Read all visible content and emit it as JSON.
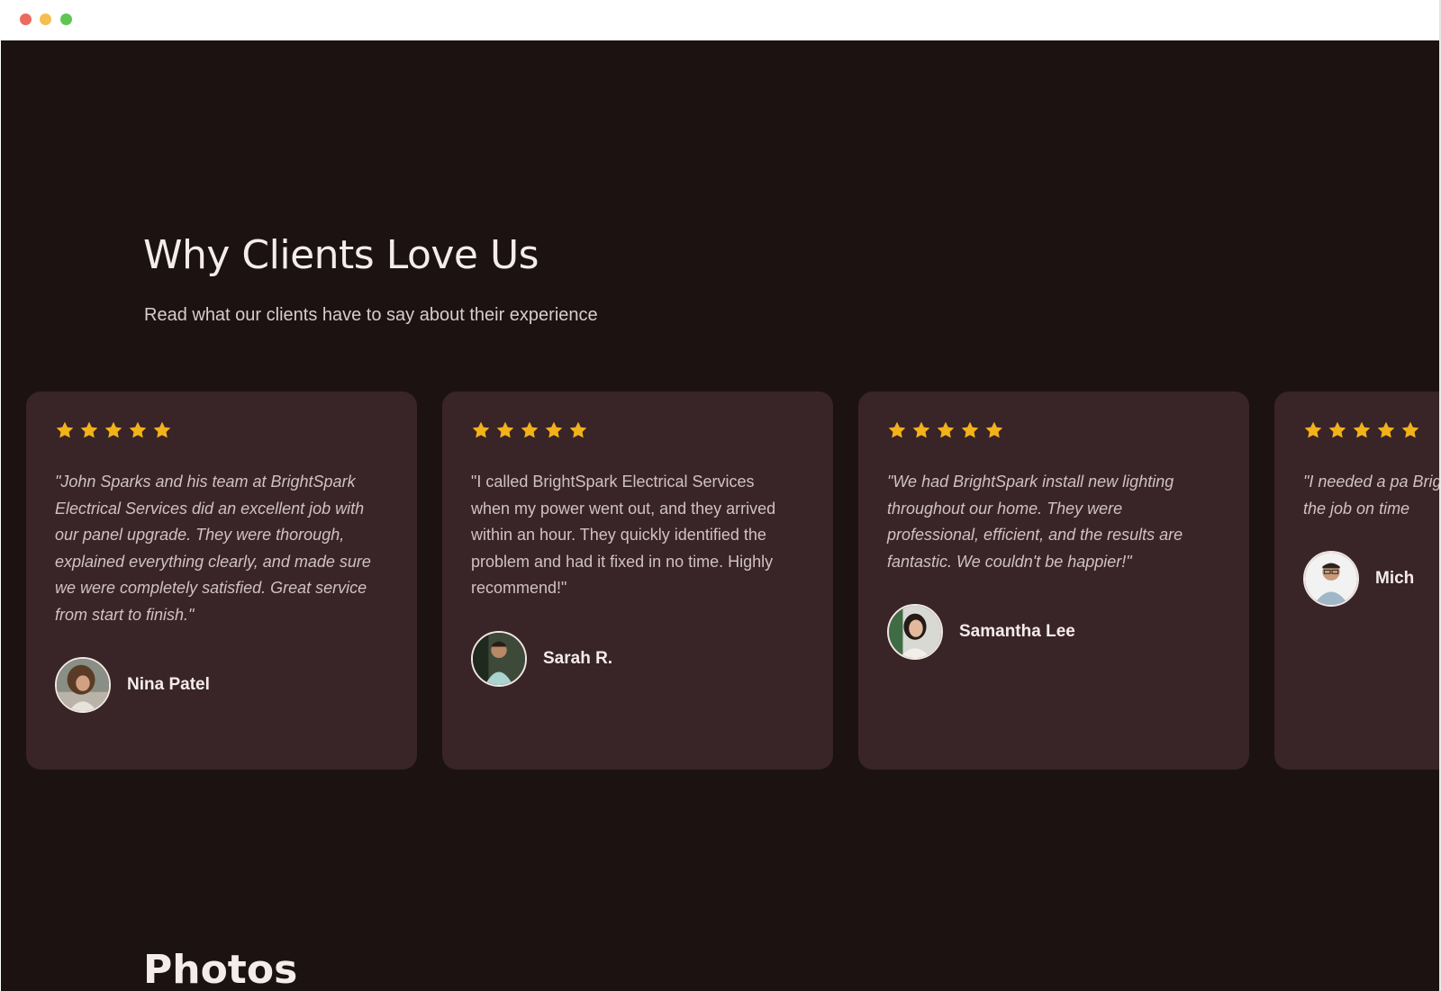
{
  "window": {
    "controls": [
      "close",
      "minimize",
      "maximize"
    ]
  },
  "testimonials_section": {
    "heading": "Why Clients Love Us",
    "subheading": "Read what our clients have to say about their experience",
    "star_color": "#f2b21b",
    "cards": [
      {
        "rating": 5,
        "quote": "",
        "italic": false,
        "author": "",
        "avatar_icon": ""
      },
      {
        "rating": 5,
        "quote": "\"John Sparks and his team at BrightSpark Electrical Services did an excellent job with our panel upgrade. They were thorough, explained everything clearly, and made sure we were completely satisfied. Great service from start to finish.\"",
        "italic": true,
        "author": "Nina Patel",
        "avatar_icon": "avatar-photo-woman-curly-hair"
      },
      {
        "rating": 5,
        "quote": "\"I called BrightSpark Electrical Services when my power went out, and they arrived within an hour. They quickly identified the problem and had it fixed in no time. Highly recommend!\"",
        "italic": false,
        "author": "Sarah R.",
        "avatar_icon": "avatar-photo-man-smiling"
      },
      {
        "rating": 5,
        "quote": "\"We had BrightSpark install new lighting throughout our home. They were professional, efficient, and the results are fantastic. We couldn't be happier!\"",
        "italic": true,
        "author": "Samantha Lee",
        "avatar_icon": "avatar-photo-woman-dark-hair"
      },
      {
        "rating": 5,
        "quote": "\"I needed a pa BrightSpark di explained ever the job on time",
        "italic": true,
        "author": "Mich",
        "avatar_icon": "avatar-photo-man-glasses"
      }
    ]
  },
  "photos_section": {
    "heading": "Photos"
  }
}
